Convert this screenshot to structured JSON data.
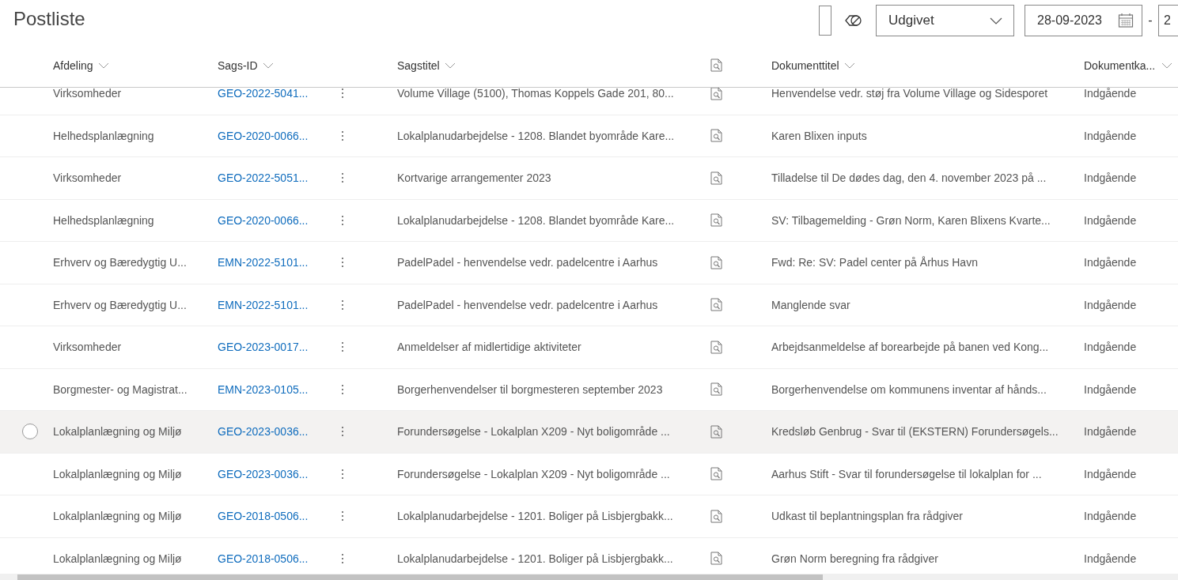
{
  "title": "Postliste",
  "toolbar": {
    "status_dropdown": {
      "value": "Udgivet"
    },
    "date_from": {
      "value": "28-09-2023"
    },
    "date_separator": "-",
    "date_to": {
      "value": "2"
    }
  },
  "table": {
    "columns": [
      {
        "label": "Afdeling"
      },
      {
        "label": "Sags-ID"
      },
      {
        "label": "Sagstitel"
      },
      {
        "label": "Dokumenttitel"
      },
      {
        "label": "Dokumentka..."
      }
    ],
    "rows": [
      {
        "afdeling": "Virksomheder",
        "sags_id": "GEO-2022-5041...",
        "sagstitel": "Volume Village (5100), Thomas Koppels Gade 201, 80...",
        "dokumenttitel": "Henvendelse vedr. støj fra Volume Village og Sidesporet",
        "kategori": "Indgående",
        "hovered": false
      },
      {
        "afdeling": "Helhedsplanlægning",
        "sags_id": "GEO-2020-0066...",
        "sagstitel": "Lokalplanudarbejdelse - 1208. Blandet byområde Kare...",
        "dokumenttitel": "Karen Blixen inputs",
        "kategori": "Indgående",
        "hovered": false
      },
      {
        "afdeling": "Virksomheder",
        "sags_id": "GEO-2022-5051...",
        "sagstitel": "Kortvarige arrangementer 2023",
        "dokumenttitel": "Tilladelse til De dødes dag, den 4. november 2023 på ...",
        "kategori": "Indgående",
        "hovered": false
      },
      {
        "afdeling": "Helhedsplanlægning",
        "sags_id": "GEO-2020-0066...",
        "sagstitel": "Lokalplanudarbejdelse - 1208. Blandet byområde Kare...",
        "dokumenttitel": "SV: Tilbagemelding - Grøn Norm, Karen Blixens Kvarte...",
        "kategori": "Indgående",
        "hovered": false
      },
      {
        "afdeling": "Erhverv og Bæredygtig U...",
        "sags_id": "EMN-2022-5101...",
        "sagstitel": "PadelPadel - henvendelse vedr. padelcentre i Aarhus",
        "dokumenttitel": "Fwd: Re: SV: Padel center på Århus Havn",
        "kategori": "Indgående",
        "hovered": false
      },
      {
        "afdeling": "Erhverv og Bæredygtig U...",
        "sags_id": "EMN-2022-5101...",
        "sagstitel": "PadelPadel - henvendelse vedr. padelcentre i Aarhus",
        "dokumenttitel": "Manglende svar",
        "kategori": "Indgående",
        "hovered": false
      },
      {
        "afdeling": "Virksomheder",
        "sags_id": "GEO-2023-0017...",
        "sagstitel": "Anmeldelser af midlertidige aktiviteter",
        "dokumenttitel": "Arbejdsanmeldelse af borearbejde på banen ved Kong...",
        "kategori": "Indgående",
        "hovered": false
      },
      {
        "afdeling": "Borgmester- og Magistrat...",
        "sags_id": "EMN-2023-0105...",
        "sagstitel": "Borgerhenvendelser til borgmesteren september 2023",
        "dokumenttitel": "Borgerhenvendelse om kommunens inventar af hånds...",
        "kategori": "Indgående",
        "hovered": false
      },
      {
        "afdeling": "Lokalplanlægning og Miljø",
        "sags_id": "GEO-2023-0036...",
        "sagstitel": "Forundersøgelse - Lokalplan X209 - Nyt boligområde ...",
        "dokumenttitel": "Kredsløb Genbrug - Svar til (EKSTERN) Forundersøgels...",
        "kategori": "Indgående",
        "hovered": true
      },
      {
        "afdeling": "Lokalplanlægning og Miljø",
        "sags_id": "GEO-2023-0036...",
        "sagstitel": "Forundersøgelse - Lokalplan X209 - Nyt boligområde ...",
        "dokumenttitel": "Aarhus Stift - Svar til forundersøgelse til lokalplan for ...",
        "kategori": "Indgående",
        "hovered": false
      },
      {
        "afdeling": "Lokalplanlægning og Miljø",
        "sags_id": "GEO-2018-0506...",
        "sagstitel": "Lokalplanudarbejdelse - 1201. Boliger på Lisbjergbakk...",
        "dokumenttitel": "Udkast til beplantningsplan fra rådgiver",
        "kategori": "Indgående",
        "hovered": false
      },
      {
        "afdeling": "Lokalplanlægning og Miljø",
        "sags_id": "GEO-2018-0506...",
        "sagstitel": "Lokalplanudarbejdelse - 1201. Boliger på Lisbjergbakk...",
        "dokumenttitel": "Grøn Norm beregning fra rådgiver",
        "kategori": "Indgående",
        "hovered": false
      }
    ]
  }
}
